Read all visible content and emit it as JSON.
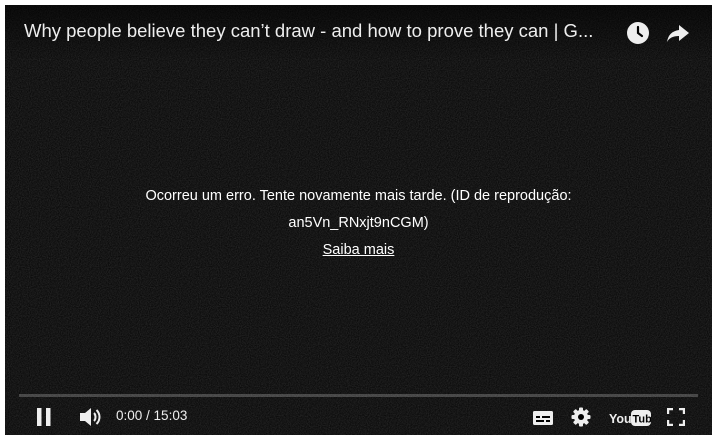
{
  "player": {
    "title": "Why people believe they can’t draw - and how to prove they can | G...",
    "error_line1": "Ocorreu um erro. Tente novamente mais tarde. (ID de reprodução:",
    "error_line2": "an5Vn_RNxjt9nCGM)",
    "learn_more": "Saiba mais",
    "time_current": "0:00",
    "time_separator": " / ",
    "time_total": "15:03",
    "progress": 0
  },
  "icons": {
    "watch_later": "clock-icon",
    "share": "share-icon",
    "play_pause": "pause-icon",
    "volume": "volume-icon",
    "subtitles": "subtitles-icon",
    "settings": "gear-icon",
    "youtube": "youtube-logo",
    "fullscreen": "fullscreen-icon"
  },
  "colors": {
    "background": "#000000",
    "text": "#ffffff",
    "progress_played": "#ff0000"
  }
}
